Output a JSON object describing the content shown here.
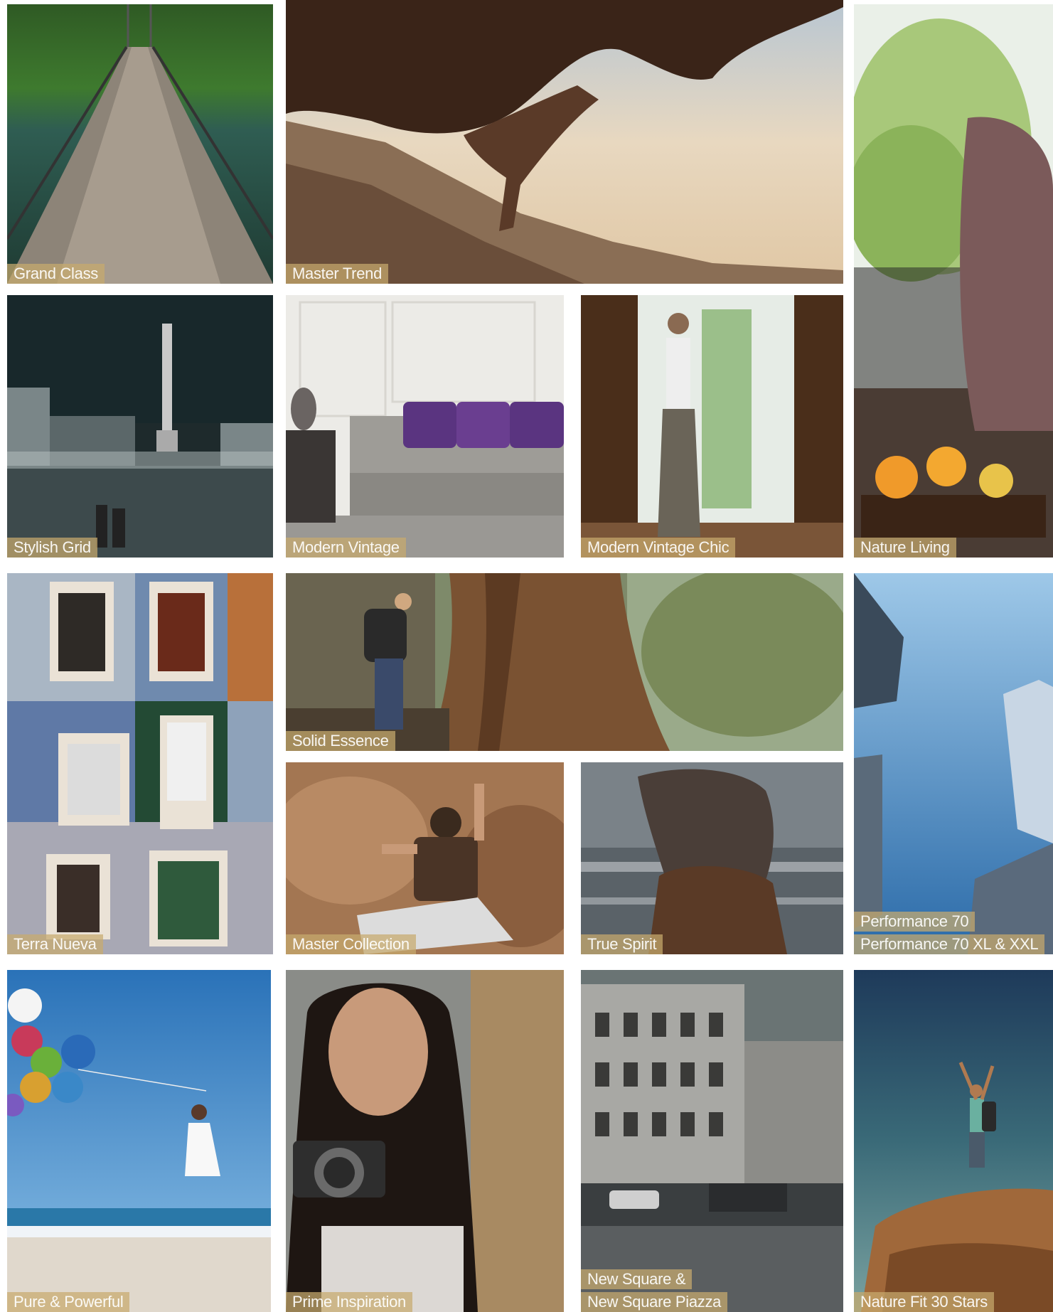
{
  "tiles": [
    {
      "id": "grand-class",
      "lines": [
        "Grand Class"
      ]
    },
    {
      "id": "master-trend",
      "lines": [
        "Master Trend"
      ]
    },
    {
      "id": "nature-living",
      "lines": [
        "Nature Living"
      ]
    },
    {
      "id": "stylish-grid",
      "lines": [
        "Stylish Grid"
      ]
    },
    {
      "id": "modern-vintage",
      "lines": [
        "Modern Vintage"
      ]
    },
    {
      "id": "modern-vintage-chic",
      "lines": [
        "Modern Vintage Chic"
      ]
    },
    {
      "id": "terra-nueva",
      "lines": [
        "Terra Nueva"
      ]
    },
    {
      "id": "solid-essence",
      "lines": [
        "Solid Essence"
      ]
    },
    {
      "id": "performance-70",
      "lines": [
        "Performance 70",
        "Performance 70 XL & XXL"
      ]
    },
    {
      "id": "master-collection",
      "lines": [
        "Master Collection"
      ]
    },
    {
      "id": "true-spirit",
      "lines": [
        "True Spirit"
      ]
    },
    {
      "id": "pure-powerful",
      "lines": [
        "Pure & Powerful"
      ]
    },
    {
      "id": "prime-inspiration",
      "lines": [
        "Prime Inspiration"
      ]
    },
    {
      "id": "new-square",
      "lines": [
        "New Square &",
        "New Square Piazza"
      ]
    },
    {
      "id": "nature-fit",
      "lines": [
        "Nature Fit 30 Stars"
      ]
    }
  ]
}
